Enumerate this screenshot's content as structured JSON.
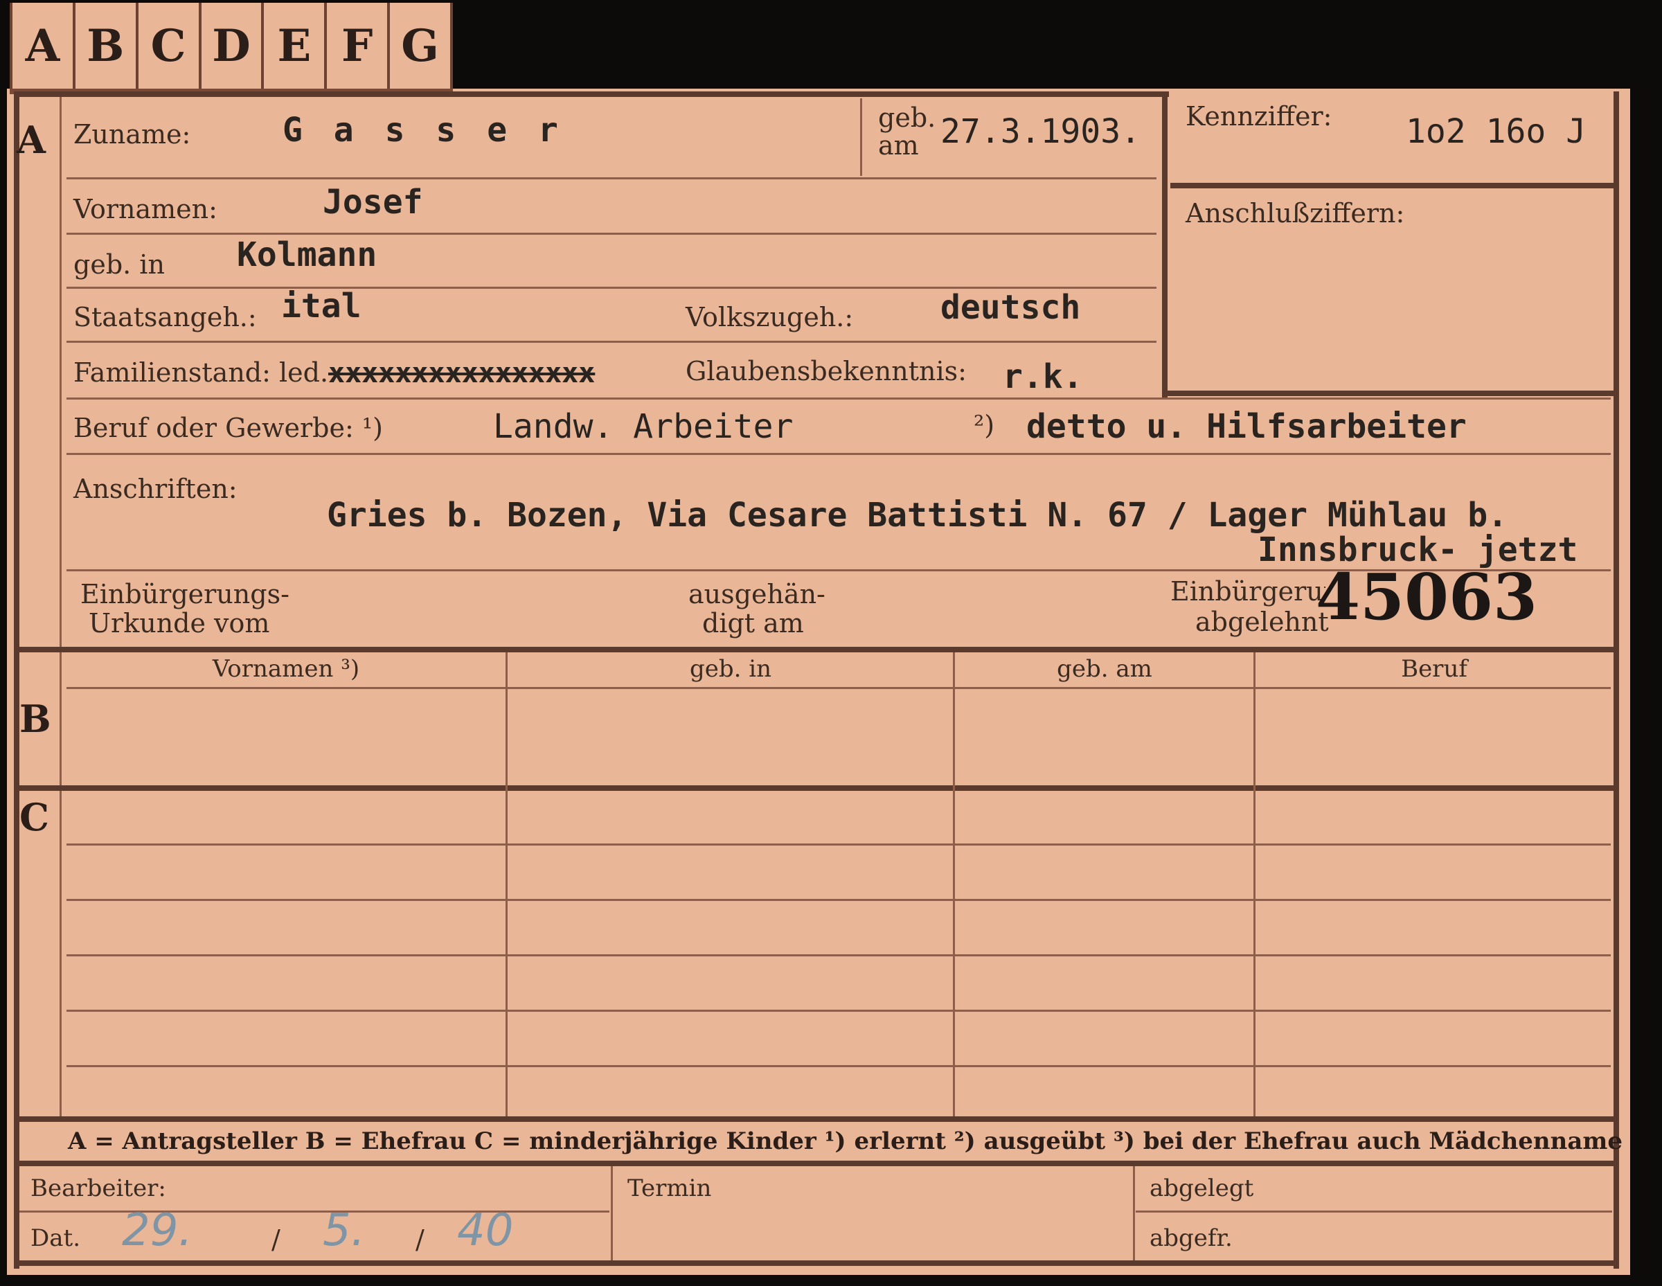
{
  "tabs": [
    "A",
    "B",
    "C",
    "D",
    "E",
    "F",
    "G"
  ],
  "section_a": {
    "letter": "A",
    "zuname_label": "Zuname:",
    "zuname_value": "G a s s e r",
    "geb_am_label_1": "geb.",
    "geb_am_label_2": "am",
    "geb_am_value": "27.3.1903.",
    "kennziffer_label": "Kennziffer:",
    "kennziffer_value": "1o2 16o J",
    "anschluss_label": "Anschlußziffern:",
    "vornamen_label": "Vornamen:",
    "vornamen_value": "Josef",
    "geb_in_label": "geb. in",
    "geb_in_value": "Kolmann",
    "staatsangeh_label": "Staatsangeh.:",
    "staatsangeh_value": "ital",
    "volkszugeh_label": "Volkszugeh.:",
    "volkszugeh_value": "deutsch",
    "familienstand_label": "Familienstand: led.",
    "familienstand_struck": "xxxxxxxxxxxxxxxx",
    "glaubens_label": "Glaubensbekenntnis:",
    "glaubens_value": "r.k.",
    "beruf_label": "Beruf oder Gewerbe: ¹)",
    "beruf_value_1": "Landw. Arbeiter",
    "beruf_marker_2": "²)",
    "beruf_value_2": "detto u. Hilfsarbeiter",
    "anschriften_label": "Anschriften:",
    "anschrift_line_1": "Gries b. Bozen, Via Cesare Battisti N. 67 / Lager Mühlau b.",
    "anschrift_line_2": "Innsbruck- jetzt",
    "einb_urkunde_label_1": "Einbürgerungs-",
    "einb_urkunde_label_2": "Urkunde vom",
    "ausgehaendigt_label_1": "ausgehän-",
    "ausgehaendigt_label_2": "digt am",
    "einb_abgelehnt_label_1": "Einbürgerung",
    "einb_abgelehnt_label_2": "abgelehnt",
    "stamp_number": "45063"
  },
  "section_b": {
    "letter": "B",
    "columns": [
      "Vornamen ³)",
      "geb. in",
      "geb. am",
      "Beruf"
    ]
  },
  "section_c": {
    "letter": "C"
  },
  "legend": "A = Antragsteller   B = Ehefrau   C = minderjährige Kinder   ¹) erlernt   ²) ausgeübt   ³) bei der Ehefrau auch Mädchenname",
  "footer": {
    "bearbeiter_label": "Bearbeiter:",
    "dat_label": "Dat.",
    "dat_day": "29.",
    "dat_sep_1": "/",
    "dat_month": "5.",
    "dat_sep_2": "/",
    "dat_year": "40",
    "termin_label": "Termin",
    "abgelegt_label": "abgelegt",
    "abgefr_label": "abgefr."
  }
}
